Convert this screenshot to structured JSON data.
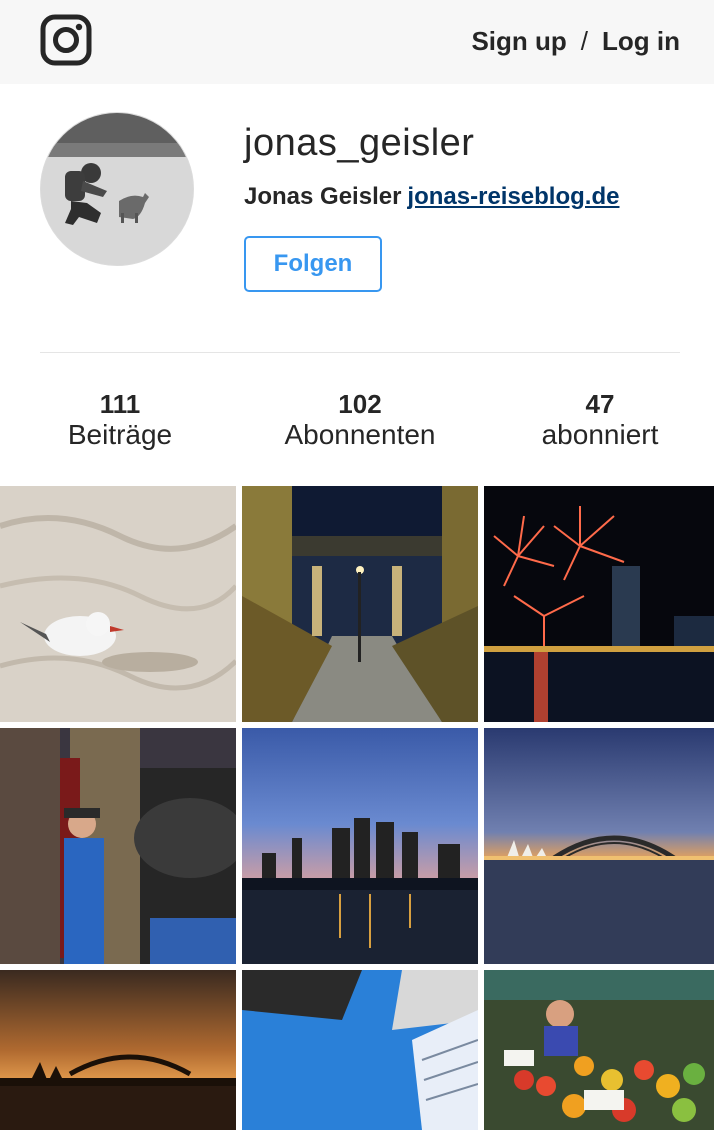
{
  "header": {
    "logo_icon": "instagram-icon",
    "signup_label": "Sign up",
    "separator": "/",
    "login_label": "Log in"
  },
  "profile": {
    "username": "jonas_geisler",
    "full_name": "Jonas Geisler",
    "website": "jonas-reiseblog.de",
    "follow_label": "Folgen"
  },
  "stats": [
    {
      "count": "111",
      "label": "Beiträge"
    },
    {
      "count": "102",
      "label": "Abonnenten"
    },
    {
      "count": "47",
      "label": "abonniert"
    }
  ],
  "colors": {
    "accent": "#3897f0",
    "link": "#003569",
    "text": "#262626",
    "topbar": "#f7f7f7"
  }
}
